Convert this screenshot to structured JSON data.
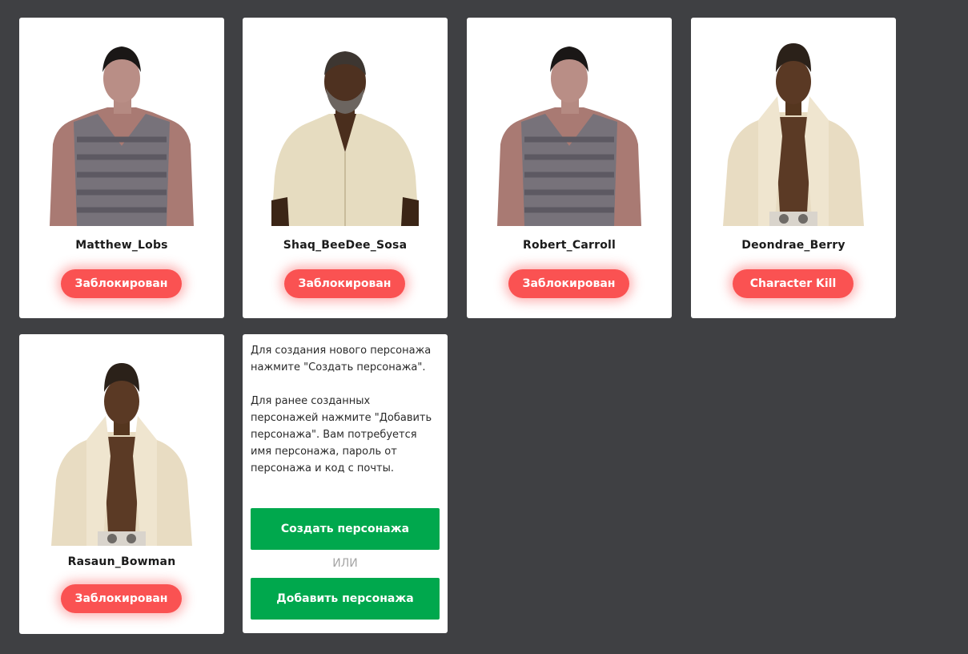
{
  "characters": [
    {
      "name": "Matthew_Lobs",
      "status": "Заблокирован",
      "avatar": "male-tank-top-avatar"
    },
    {
      "name": "Shaq_BeeDee_Sosa",
      "status": "Заблокирован",
      "avatar": "bearded-man-avatar"
    },
    {
      "name": "Robert_Carroll",
      "status": "Заблокирован",
      "avatar": "male-tank-top-avatar"
    },
    {
      "name": "Deondrae_Berry",
      "status": "Character Kill",
      "avatar": "open-jacket-man-avatar"
    },
    {
      "name": "Rasaun_Bowman",
      "status": "Заблокирован",
      "avatar": "open-jacket-man-avatar"
    }
  ],
  "info": {
    "text_create": "Для создания нового персонажа нажмите \"Создать персонажа\".",
    "text_add": "Для ранее созданных персонажей нажмите \"Добавить персонажа\". Вам потребуется имя персонажа, пароль от персонажа и код с почты.",
    "create_button": "Создать персонажа",
    "or_label": "ИЛИ",
    "add_button": "Добавить персонажа"
  },
  "colors": {
    "background": "#3f4043",
    "card": "#ffffff",
    "status_red": "#fa5252",
    "action_green": "#00a84d"
  }
}
